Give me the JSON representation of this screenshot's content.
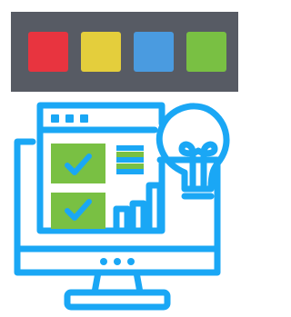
{
  "palette": {
    "swatches": [
      {
        "name": "red",
        "color": "#e8343f"
      },
      {
        "name": "yellow",
        "color": "#e4ce3c"
      },
      {
        "name": "blue",
        "color": "#4a9be0"
      },
      {
        "name": "green",
        "color": "#79c043"
      }
    ]
  },
  "icon": {
    "name": "monitor-dashboard-idea-icon",
    "stroke_color": "#1aa7f5",
    "fill_color": "#79c043",
    "check_color": "#1aa7f5"
  }
}
